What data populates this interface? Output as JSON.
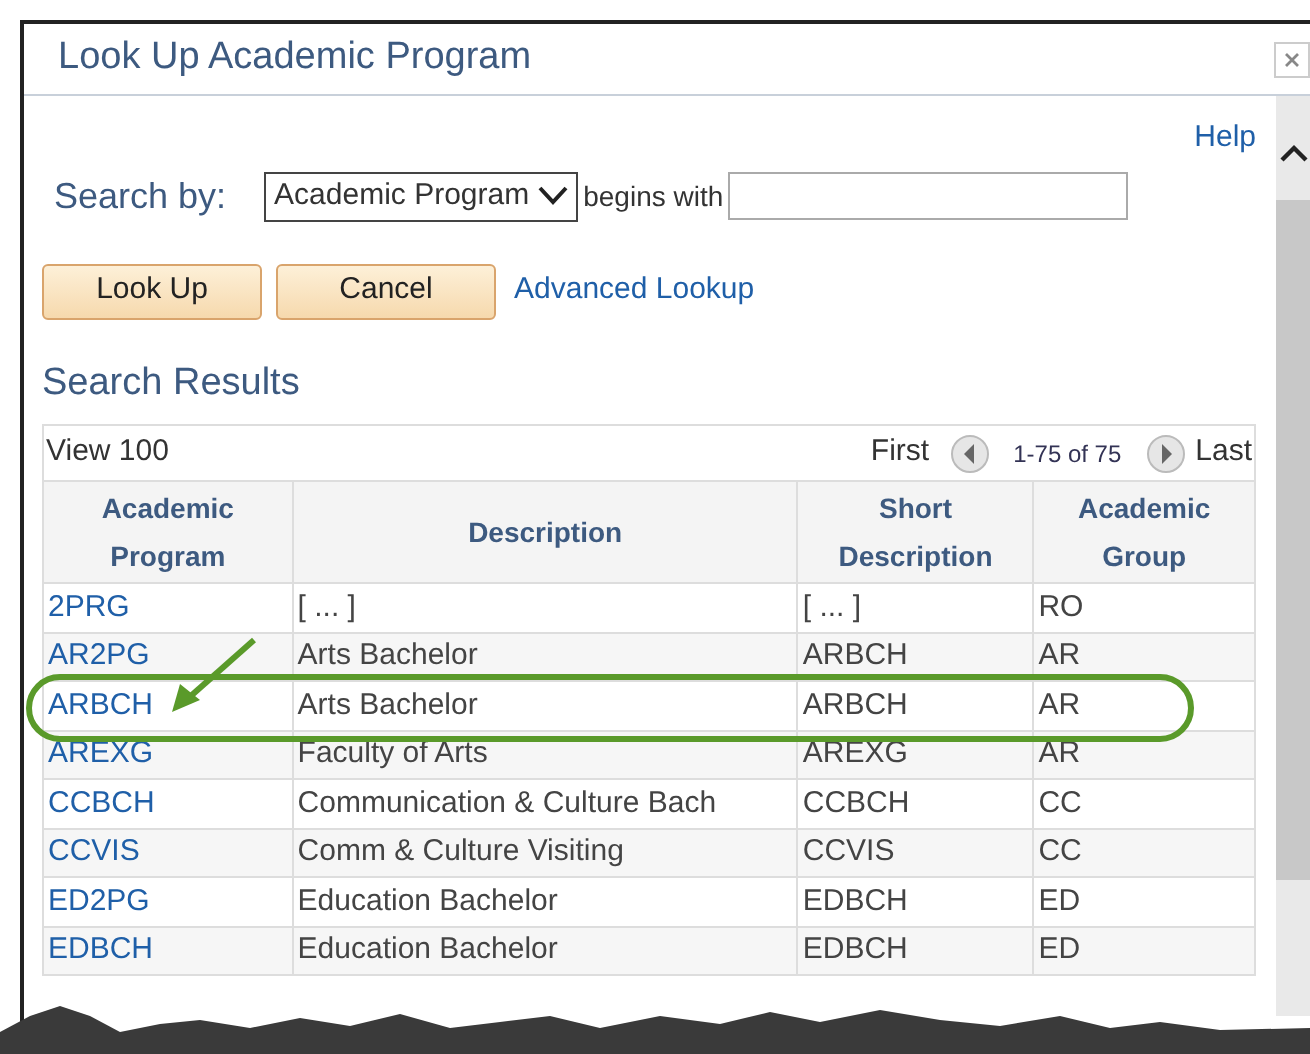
{
  "window": {
    "title": "Look Up Academic Program"
  },
  "help_link": "Help",
  "search": {
    "label": "Search by:",
    "field": "Academic Program",
    "operator": "begins with"
  },
  "buttons": [
    "Look Up",
    "Cancel"
  ],
  "advanced_link": "Advanced Lookup",
  "results": {
    "title": "Search Results",
    "view": "View 100",
    "first": "First",
    "range": "1-75 of 75",
    "last": "Last",
    "columns": [
      "Academic Program",
      "Description",
      "Short Description",
      "Academic Group"
    ],
    "rows": [
      {
        "cells": [
          "2PRG",
          "[ ... ]",
          "[ ... ]",
          "RO"
        ],
        "circled": false
      },
      {
        "cells": [
          "AR2PG",
          "Arts Bachelor",
          "ARBCH",
          "AR"
        ],
        "circled": false
      },
      {
        "cells": [
          "ARBCH",
          "Arts Bachelor",
          "ARBCH",
          "AR"
        ],
        "circled": true
      },
      {
        "cells": [
          "AREXG",
          "Faculty of Arts",
          "AREXG",
          "AR"
        ],
        "circled": false
      },
      {
        "cells": [
          "CCBCH",
          "Communication & Culture Bach",
          "CCBCH",
          "CC"
        ],
        "circled": false
      },
      {
        "cells": [
          "CCVIS",
          "Comm & Culture Visiting",
          "CCVIS",
          "CC"
        ],
        "circled": false
      },
      {
        "cells": [
          "ED2PG",
          "Education Bachelor",
          "EDBCH",
          "ED"
        ],
        "circled": false
      },
      {
        "cells": [
          "EDBCH",
          "Education Bachelor",
          "EDBCH",
          "ED"
        ],
        "circled": false
      }
    ]
  }
}
